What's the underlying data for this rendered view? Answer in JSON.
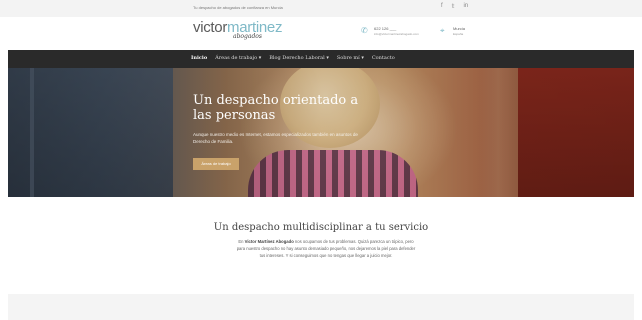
{
  "topbar": {
    "tagline": "Tu despacho de abogados de confianza en Murcia",
    "social": [
      {
        "icon": "facebook-icon",
        "glyph": "f"
      },
      {
        "icon": "twitter-icon",
        "glyph": "𝕥"
      },
      {
        "icon": "linkedin-icon",
        "glyph": "in"
      }
    ]
  },
  "header": {
    "logo_name_part1": "victor",
    "logo_name_part2": "martinez",
    "logo_signature": "abogados",
    "phone": {
      "label": "622 126 ___",
      "sub": "info@victormartinezabogado.com"
    },
    "location": {
      "label": "Murcia",
      "sub": "España"
    }
  },
  "nav": {
    "items": [
      {
        "label": "Inicio",
        "active": true
      },
      {
        "label": "Áreas de trabajo ▾",
        "active": false
      },
      {
        "label": "Blog Derecho Laboral ▾",
        "active": false
      },
      {
        "label": "Sobre mí ▾",
        "active": false
      },
      {
        "label": "Contacto",
        "active": false
      }
    ]
  },
  "hero": {
    "title": "Un despacho orientado a las personas",
    "text": "Aunque nuestro medio es Internet, estamos especializados también en asuntos de Derecho de Familia.",
    "cta_label": "Áreas de trabajo"
  },
  "intro": {
    "title": "Un despacho multidisciplinar a tu servicio",
    "brand": "Victor Martínez Abogado",
    "text_before": "En ",
    "text_after": " nos ocupamos de tus problemas. Quizá parezca un tópico, pero para nuestro despacho no hay asunto demasiado pequeño, nos dejaremos la piel para defender tus intereses. Y si conseguimos que no tengas que llegar a juicio mejor."
  },
  "colors": {
    "accent": "#7fb9c7",
    "nav_bg": "#2a2a2a",
    "cta": "#c9a26a"
  }
}
